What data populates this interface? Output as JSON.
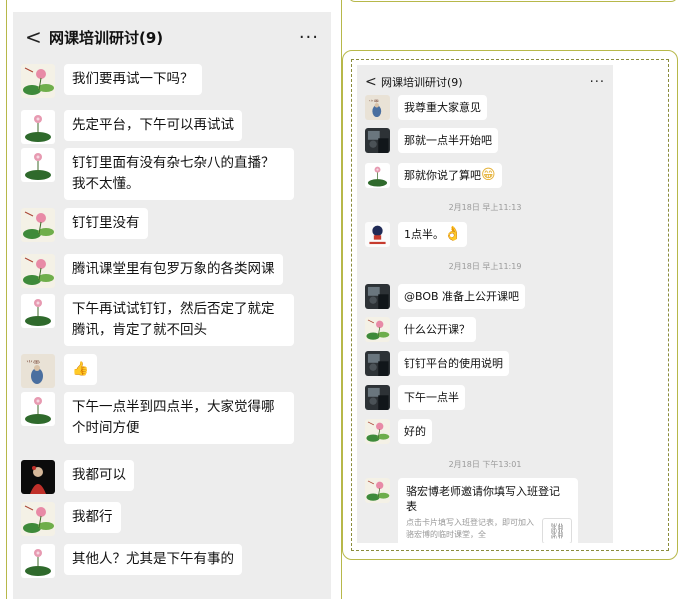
{
  "left_panel": {
    "header": {
      "back": "<",
      "title": "网课培训研讨(9)",
      "more": "···"
    },
    "messages": [
      {
        "avatar": "lotus-painting",
        "text": "我们要再试一下吗？"
      },
      {
        "avatar": "lotus-leaf",
        "text": "先定平台，下午可以再试试"
      },
      {
        "avatar": "lotus-leaf",
        "text": "钉钉里面有没有杂七杂八的直播？我不太懂。"
      },
      {
        "avatar": "lotus-painting",
        "text": "钉钉里没有"
      },
      {
        "avatar": "lotus-painting",
        "text": "腾讯课堂里有包罗万象的各类网课"
      },
      {
        "avatar": "lotus-leaf",
        "text": "下午再试试钉钉，然后否定了就定腾讯，肯定了就不回头"
      },
      {
        "avatar": "calligraphy",
        "text": "👍"
      },
      {
        "avatar": "lotus-leaf",
        "text": "下午一点半到四点半，大家觉得哪个时间方便"
      },
      {
        "avatar": "red-figure",
        "text": "我都可以"
      },
      {
        "avatar": "lotus-painting",
        "text": "我都行"
      },
      {
        "avatar": "lotus-leaf",
        "text": "其他人？尤其是下午有事的"
      }
    ]
  },
  "right_panel": {
    "header": {
      "back": "<",
      "title": "网课培训研讨(9)",
      "more": "···"
    },
    "messages": [
      {
        "kind": "text",
        "avatar": "calligraphy",
        "text": "我尊重大家意见"
      },
      {
        "kind": "text",
        "avatar": "dark-photo",
        "text": "那就一点半开始吧"
      },
      {
        "kind": "text",
        "avatar": "lotus-leaf",
        "text": "那就你说了算吧",
        "emoji": "😁"
      },
      {
        "kind": "time",
        "text": "2月18日 早上11:13"
      },
      {
        "kind": "text",
        "avatar": "poster",
        "text": "1点半。",
        "emoji": "👌"
      },
      {
        "kind": "time",
        "text": "2月18日 早上11:19"
      },
      {
        "kind": "text",
        "avatar": "dark-photo",
        "text": "@BOB  准备上公开课吧"
      },
      {
        "kind": "text",
        "avatar": "lotus-painting",
        "text": "什么公开课？"
      },
      {
        "kind": "text",
        "avatar": "dark-photo",
        "text": "钉钉平台的使用说明"
      },
      {
        "kind": "text",
        "avatar": "dark-photo",
        "text": "下午一点半"
      },
      {
        "kind": "text",
        "avatar": "lotus-painting",
        "text": "好的"
      },
      {
        "kind": "time",
        "text": "2月18日 下午13:01"
      },
      {
        "kind": "card",
        "avatar": "lotus-painting",
        "title": "骆宏博老师邀请你填写入班登记表",
        "desc": "点击卡片填写入班登记表，即可加入骆宏博的临时课堂，全",
        "icon": "link-icon"
      }
    ]
  }
}
